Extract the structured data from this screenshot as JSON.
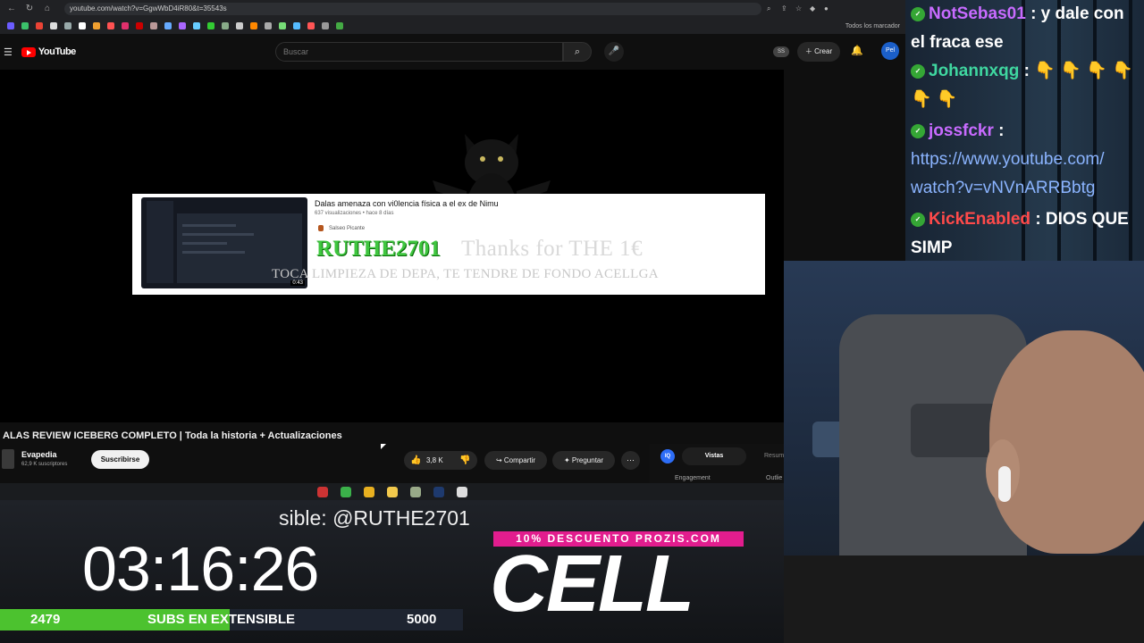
{
  "browser": {
    "url": "youtube.com/watch?v=GgwWbD4iR80&t=35543s",
    "bookmarks_all": "Todos los marcador"
  },
  "youtube": {
    "logo": "YouTube",
    "search_placeholder": "Buscar",
    "create_label": "Crear",
    "ss_badge": "SS",
    "avatar": "Pel"
  },
  "alert": {
    "video_title": "Dalas amenaza con vi0lencia física a el ex de Nimu",
    "video_meta": "637 visualizaciones • hace 8 días",
    "channel": "Salseo Picante",
    "duration": "0:43",
    "donor": "RUTHE2701",
    "thanks": "Thanks for THE 1€",
    "message": "TOCA LIMPIEZA DE DEPA, TE TENDRE DE FONDO ACELLGA"
  },
  "video": {
    "title": "ALAS REVIEW ICEBERG COMPLETO | Toda la historia + Actualizaciones",
    "channel": "Evapedia",
    "subscribers": "62,9 K suscriptores",
    "subscribe_label": "Suscribirse",
    "likes": "3,8 K",
    "share_label": "Compartir",
    "ask_label": "Preguntar"
  },
  "iq_panel": {
    "logo": "IQ",
    "tab_views": "Vistas",
    "tab_summary": "Resum",
    "engagement": "Engagement",
    "outliers": "Outlie"
  },
  "chat": [
    {
      "user": "NotSebas01",
      "color": "#c86bff",
      "text": ": y dale con",
      "text2": "el fraca ese"
    },
    {
      "user": "Johannxqg",
      "color": "#3fd7a0",
      "text": ": 👇 👇 👇 👇",
      "text2": "👇 👇"
    },
    {
      "user": "jossfckr",
      "color": "#c86bff",
      "text": ":",
      "text2": "https://www.youtube.com/",
      "text3": "watch?v=vNVnARRBbtg"
    },
    {
      "user": "KickEnabled",
      "color": "#ff4a4a",
      "text": ": DIOS QUE",
      "text2": "SIMP"
    }
  ],
  "overlay": {
    "tts": "sible: @RUTHE2701",
    "timer": "03:16:26",
    "subs_current": "2479",
    "subs_label": "SUBS EN EXTENSIBLE",
    "subs_goal": "5000",
    "subs_progress": 0.4958,
    "promo": "10% DESCUENTO PROZIS.COM",
    "sponsor": "CELL"
  }
}
